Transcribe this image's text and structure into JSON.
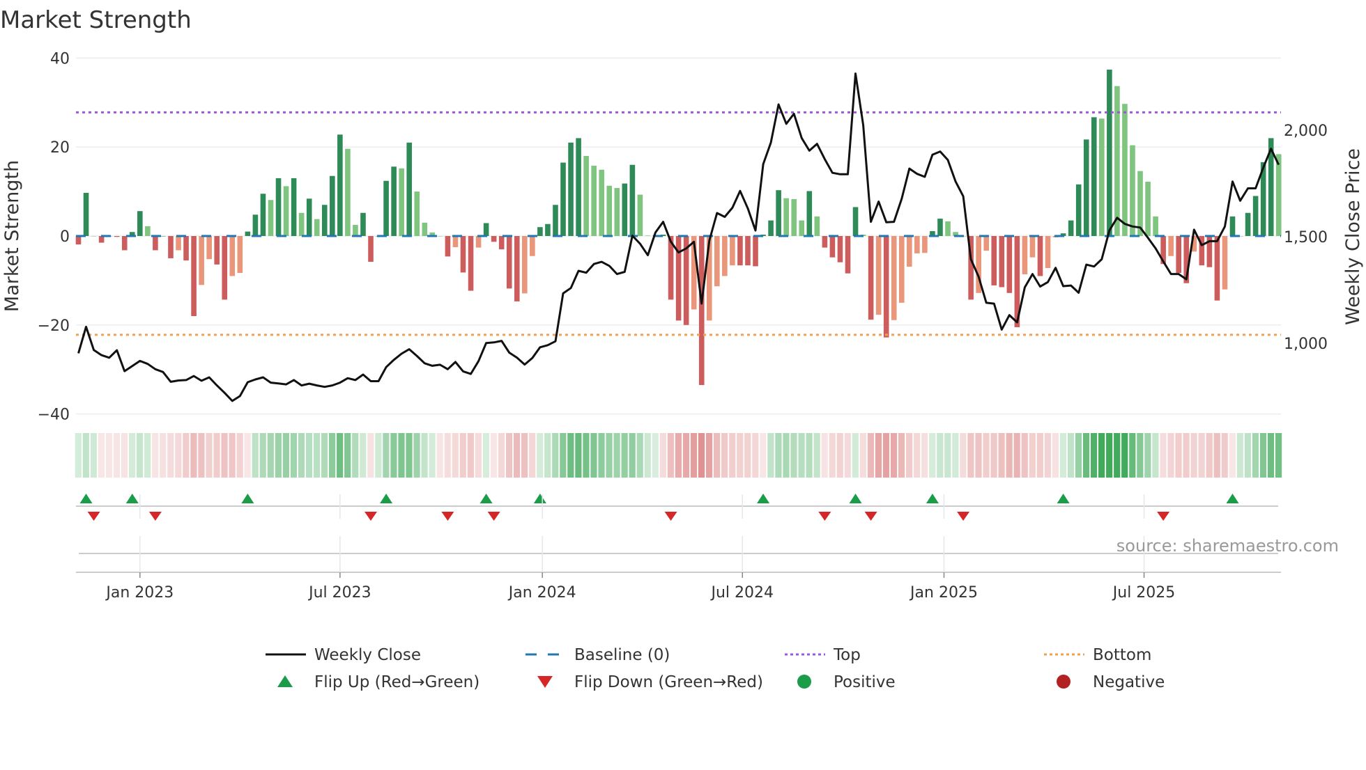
{
  "chart_data": {
    "type": "bar",
    "title": "Market Strength",
    "ylabel": "Market Strength",
    "y2label": "Weekly Close Price",
    "ylim": [
      -40,
      40
    ],
    "y2lim": [
      750,
      2300
    ],
    "yticks": [
      "40",
      "20",
      "0",
      "−20",
      "−40"
    ],
    "ytick_values": [
      40,
      20,
      0,
      -20,
      -40
    ],
    "y2ticks": [
      "2,000",
      "1,500",
      "1,000"
    ],
    "y2tick_values": [
      2000,
      1500,
      1000
    ],
    "xticks": [
      "Jan 2023",
      "Jul 2023",
      "Jan 2024",
      "Jul 2024",
      "Jan 2025",
      "Jul 2025"
    ],
    "xtick_week_index": [
      8,
      34,
      60.3,
      86.3,
      112.5,
      138.5
    ],
    "frequency": "weekly",
    "top_level": 27.8,
    "bottom_level": -22.2,
    "baseline": 0,
    "strength": [
      -1.9,
      9.7,
      0,
      -1.5,
      0,
      -0.2,
      -3.2,
      0.9,
      5.6,
      2.2,
      -3.2,
      0,
      -5,
      -3.2,
      -5.5,
      -18,
      -11,
      -5.2,
      -6.4,
      -14.3,
      -9,
      -8.3,
      1,
      4.8,
      9.5,
      8.1,
      13,
      11.2,
      13,
      5.2,
      8.4,
      3.8,
      7,
      13.5,
      22.8,
      19.6,
      2.5,
      5.2,
      -5.8,
      0,
      12.4,
      15.6,
      15.2,
      21,
      10,
      3,
      0.8,
      0,
      -4.6,
      -2.5,
      -8.2,
      -12.3,
      -2.6,
      2.9,
      -1.3,
      -3,
      -11.8,
      -14.7,
      -12.9,
      -4.5,
      2,
      2.7,
      7,
      16.5,
      21,
      22,
      18,
      15.8,
      14.9,
      11.3,
      10.8,
      11.8,
      16,
      9.3,
      0.1,
      0.2,
      0.3,
      -14.3,
      -19,
      -20,
      -16.5,
      -33.5,
      -19,
      -11.3,
      -9,
      -6.6,
      -6.6,
      -6.6,
      -6.8,
      0.3,
      3.5,
      10.3,
      8.5,
      8.3,
      3.5,
      10.1,
      4.4,
      -2.6,
      -4.8,
      -5.9,
      -8.4,
      6.5,
      0.3,
      -18.8,
      -17.7,
      -22.8,
      -18.9,
      -15,
      -6.9,
      -3.9,
      -3.8,
      1.1,
      3.9,
      3.3,
      0.9,
      0,
      -14.3,
      -12.8,
      -3.3,
      -11.1,
      -11.5,
      -12.8,
      -20.5,
      -8.6,
      -4.8,
      -9,
      -7.2,
      -0.3,
      0.6,
      3.5,
      11.6,
      21.7,
      26.7,
      26.4,
      37.4,
      33.7,
      29.7,
      20.4,
      14.6,
      12.2,
      4.4,
      -6.3,
      -4.5,
      -8.3,
      -10.6,
      -3.5,
      -6.6,
      -7,
      -14.5,
      -12,
      4.4,
      0,
      5.2,
      9,
      16.6,
      22,
      18.4
    ],
    "weekly_close": [
      953,
      1077,
      968,
      944,
      932,
      967,
      869,
      893,
      917,
      903,
      878,
      865,
      819,
      825,
      827,
      846,
      824,
      840,
      802,
      767,
      729,
      752,
      817,
      830,
      840,
      815,
      811,
      807,
      827,
      802,
      810,
      802,
      795,
      802,
      815,
      836,
      827,
      853,
      822,
      822,
      888,
      922,
      951,
      972,
      940,
      906,
      894,
      899,
      878,
      912,
      868,
      856,
      916,
      1001,
      1004,
      1011,
      956,
      932,
      900,
      931,
      981,
      991,
      1009,
      1234,
      1259,
      1340,
      1331,
      1372,
      1382,
      1363,
      1325,
      1335,
      1505,
      1467,
      1413,
      1520,
      1570,
      1476,
      1426,
      1445,
      1476,
      1186,
      1482,
      1611,
      1593,
      1636,
      1715,
      1633,
      1529,
      1841,
      1942,
      2121,
      2030,
      2077,
      1963,
      1904,
      1936,
      1864,
      1800,
      1793,
      1793,
      2266,
      2024,
      1570,
      1665,
      1568,
      1570,
      1678,
      1820,
      1795,
      1781,
      1885,
      1900,
      1860,
      1759,
      1690,
      1394,
      1312,
      1190,
      1186,
      1064,
      1132,
      1098,
      1262,
      1325,
      1266,
      1287,
      1354,
      1268,
      1271,
      1237,
      1369,
      1360,
      1394,
      1530,
      1589,
      1560,
      1548,
      1543,
      1495,
      1445,
      1384,
      1325,
      1325,
      1300,
      1533,
      1460,
      1479,
      1479,
      1548,
      1759,
      1669,
      1727,
      1727,
      1825,
      1913,
      1838
    ],
    "flip_up_week_index": [
      1,
      7,
      22,
      40,
      53,
      60,
      89,
      101,
      111,
      128,
      150
    ],
    "flip_down_week_index": [
      2,
      10,
      38,
      48,
      54,
      77,
      97,
      103,
      115,
      141
    ],
    "legend": {
      "position": "bottom",
      "items": [
        {
          "label": "Weekly Close",
          "symbol": "line"
        },
        {
          "label": "Baseline (0)",
          "symbol": "dash"
        },
        {
          "label": "Top",
          "symbol": "dotted"
        },
        {
          "label": "Bottom",
          "symbol": "dotted"
        },
        {
          "label": "Flip Up (Red→Green)",
          "symbol": "triangle-up"
        },
        {
          "label": "Flip Down (Green→Red)",
          "symbol": "triangle-down"
        },
        {
          "label": "Positive",
          "symbol": "circle"
        },
        {
          "label": "Negative",
          "symbol": "circle"
        }
      ]
    },
    "source": "source: sharemaestro.com",
    "grid": true
  },
  "colors": {
    "pos_strong": "#2e8b57",
    "pos_weak": "#7fc47f",
    "neg_strong": "#cd5c5c",
    "neg_weak": "#e9967a",
    "close_line": "#111111",
    "baseline": "#1f77b4",
    "top": "#9b59d6",
    "bottom": "#f0a050",
    "flip_up": "#1a9c48",
    "flip_down": "#d62728",
    "positive": "#1a9c48",
    "negative": "#b22222"
  }
}
